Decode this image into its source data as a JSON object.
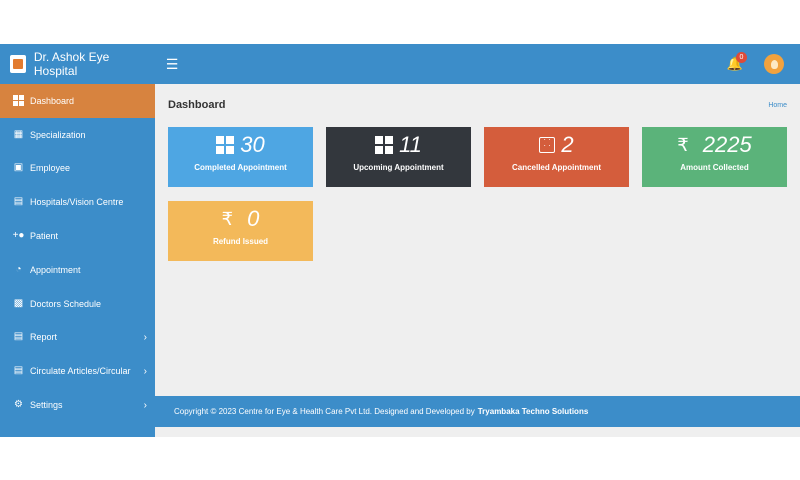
{
  "header": {
    "brand": "Dr. Ashok Eye Hospital",
    "notifications": "0"
  },
  "sidebar": {
    "items": [
      {
        "label": "Dashboard",
        "icon": "dashboard-icon",
        "active": true
      },
      {
        "label": "Specialization",
        "icon": "building-icon"
      },
      {
        "label": "Employee",
        "icon": "id-card-icon"
      },
      {
        "label": "Hospitals/Vision Centre",
        "icon": "hospital-icon"
      },
      {
        "label": "Patient",
        "icon": "user-plus-icon"
      },
      {
        "label": "Appointment",
        "icon": "stopwatch-icon"
      },
      {
        "label": "Doctors Schedule",
        "icon": "calendar-icon"
      },
      {
        "label": "Report",
        "icon": "report-icon",
        "has_children": true
      },
      {
        "label": "Circulate Articles/Circular",
        "icon": "article-icon",
        "has_children": true
      },
      {
        "label": "Settings",
        "icon": "gear-icon",
        "has_children": true
      }
    ]
  },
  "main": {
    "title": "Dashboard",
    "breadcrumb": "Home",
    "tiles": [
      {
        "value": "30",
        "label": "Completed Appointment",
        "color": "#4ea6e3",
        "icon": "grid-icon"
      },
      {
        "value": "11",
        "label": "Upcoming Appointment",
        "color": "#33373d",
        "icon": "grid-icon"
      },
      {
        "value": "2",
        "label": "Cancelled Appointment",
        "color": "#d45d3c",
        "icon": "dice-icon"
      },
      {
        "value": "2225",
        "label": "Amount Collected",
        "color": "#5bb37a",
        "icon": "rupee-icon",
        "prefix": "₹"
      },
      {
        "value": "0",
        "label": "Refund Issued",
        "color": "#f3b95a",
        "icon": "rupee-icon",
        "prefix": "₹"
      }
    ]
  },
  "footer": {
    "text": "Copyright © 2023 Centre for Eye & Health Care Pvt Ltd. Designed and Developed by",
    "company": "Tryambaka Techno Solutions"
  },
  "colors": {
    "primary": "#3c8dc9",
    "active": "#d7833f",
    "background": "#efefef"
  }
}
